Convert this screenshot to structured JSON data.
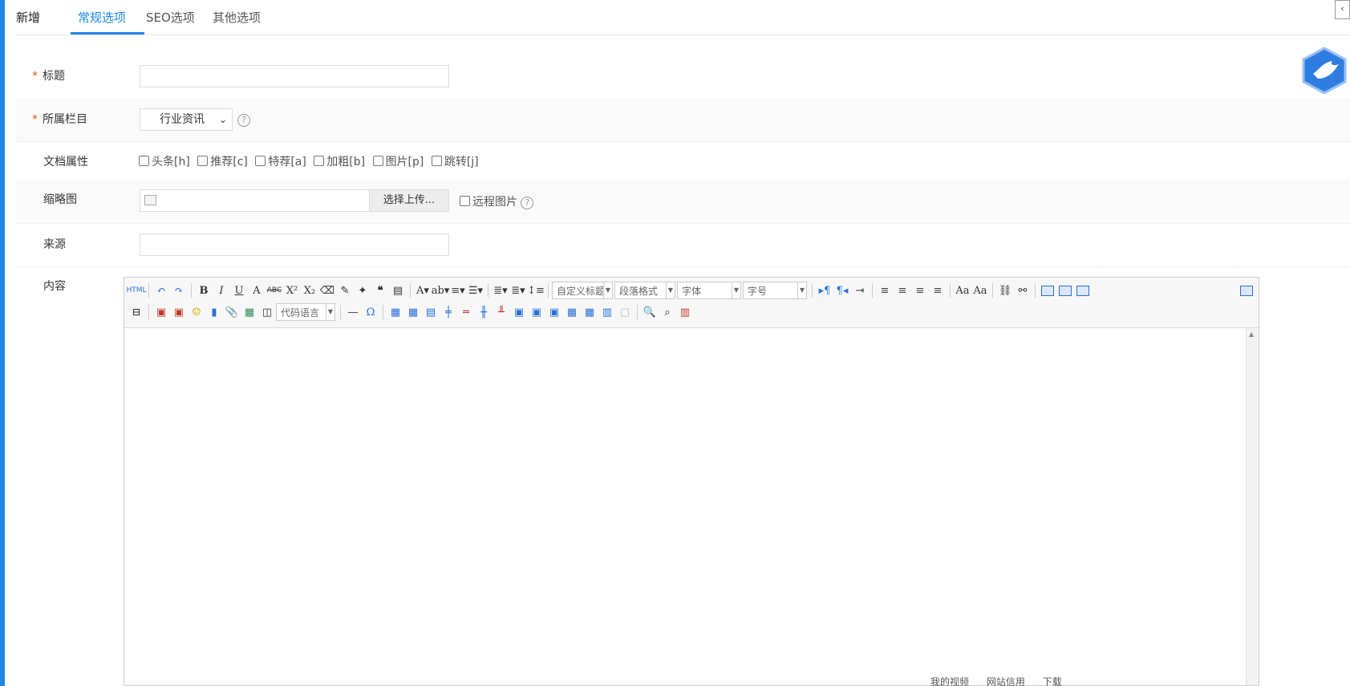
{
  "header": {
    "page_title": "新增",
    "tabs": [
      {
        "label": "常规选项",
        "active": true
      },
      {
        "label": "SEO选项",
        "active": false
      },
      {
        "label": "其他选项",
        "active": false
      }
    ]
  },
  "form": {
    "title_label": "标题",
    "category_label": "所属栏目",
    "category_value": "行业资讯",
    "attrs_label": "文档属性",
    "attrs": [
      "头条[h]",
      "推荐[c]",
      "特荐[a]",
      "加粗[b]",
      "图片[p]",
      "跳转[j]"
    ],
    "thumb_label": "缩略图",
    "upload_button": "选择上传...",
    "remote_image": "远程图片",
    "source_label": "来源",
    "content_label": "内容",
    "required_mark": "*",
    "help_glyph": "?"
  },
  "editor": {
    "combos": {
      "custom_heading": "自定义标题",
      "paragraph": "段落格式",
      "font": "字体",
      "size": "字号",
      "code_lang": "代码语言"
    },
    "html_label": "HTML"
  },
  "statusbar": {
    "items": [
      "我的视频",
      "网站信用",
      "下载"
    ]
  },
  "colors": {
    "accent": "#1e88e5",
    "required": "#e8590c"
  }
}
